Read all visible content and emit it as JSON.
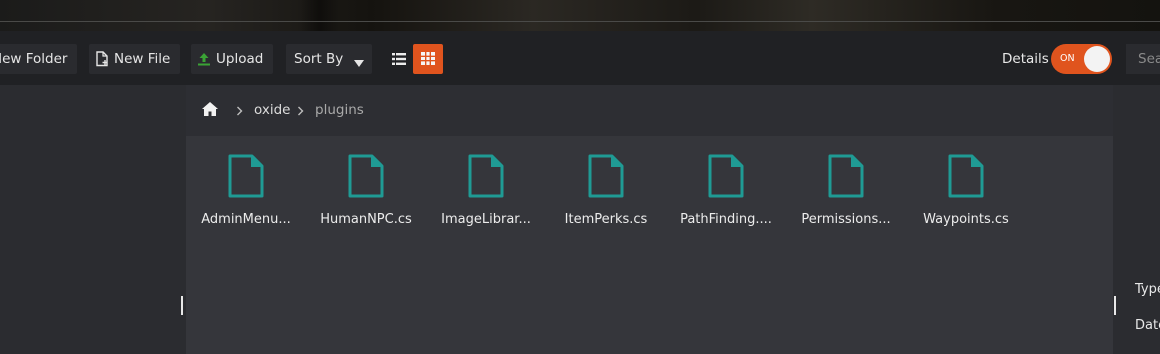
{
  "toolbar": {
    "new_folder": "New Folder",
    "new_file": "New File",
    "upload": "Upload",
    "sort_by": "Sort By",
    "details_label": "Details",
    "toggle_text": "ON",
    "search_placeholder": "Search",
    "accent_color": "#e0541e"
  },
  "breadcrumb": {
    "items": [
      "oxide",
      "plugins"
    ]
  },
  "files": [
    {
      "name": "AdminMenu...",
      "icon": "file-icon"
    },
    {
      "name": "HumanNPC.cs",
      "icon": "file-icon"
    },
    {
      "name": "ImageLibrar...",
      "icon": "file-icon"
    },
    {
      "name": "ItemPerks.cs",
      "icon": "file-icon"
    },
    {
      "name": "PathFinding....",
      "icon": "file-icon"
    },
    {
      "name": "Permissions...",
      "icon": "file-icon"
    },
    {
      "name": "Waypoints.cs",
      "icon": "file-icon"
    }
  ],
  "details": {
    "type_label": "Type",
    "date_label": "Date"
  }
}
